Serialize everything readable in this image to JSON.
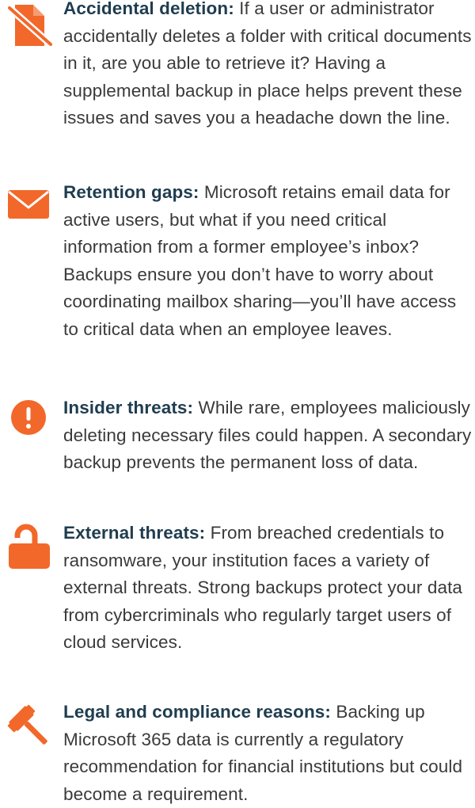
{
  "items": [
    {
      "icon": "document-crossed-icon",
      "heading": "Accidental deletion:",
      "body": " If a user or administrator accidentally deletes a folder with critical documents in it, are you able to retrieve it? Having a supplemental backup in place helps prevent these issues and saves you a headache down the line."
    },
    {
      "icon": "envelope-icon",
      "heading": "Retention gaps:",
      "body": " Microsoft retains email data for active users, but what if you need critical information from a former employee’s inbox? Backups ensure you don’t have to worry about coordinating mailbox sharing—you’ll have access to critical data when an employee leaves."
    },
    {
      "icon": "exclamation-circle-icon",
      "heading": "Insider threats:",
      "body": " While rare, employees maliciously deleting necessary files could happen. A secondary backup prevents the permanent loss of data."
    },
    {
      "icon": "unlocked-padlock-icon",
      "heading": "External threats:",
      "body": " From breached credentials to ransomware, your institution faces a variety of external threats. Strong backups protect your data from cybercriminals who regularly target users of cloud services."
    },
    {
      "icon": "gavel-icon",
      "heading": "Legal and compliance reasons:",
      "body": " Backing up Microsoft 365 data is currently a regulatory recommendation for financial institutions but could become a requirement."
    }
  ],
  "colors": {
    "icon_orange": "#f2682a",
    "heading": "#1f3d4f",
    "body_text": "#3a3a3a"
  }
}
